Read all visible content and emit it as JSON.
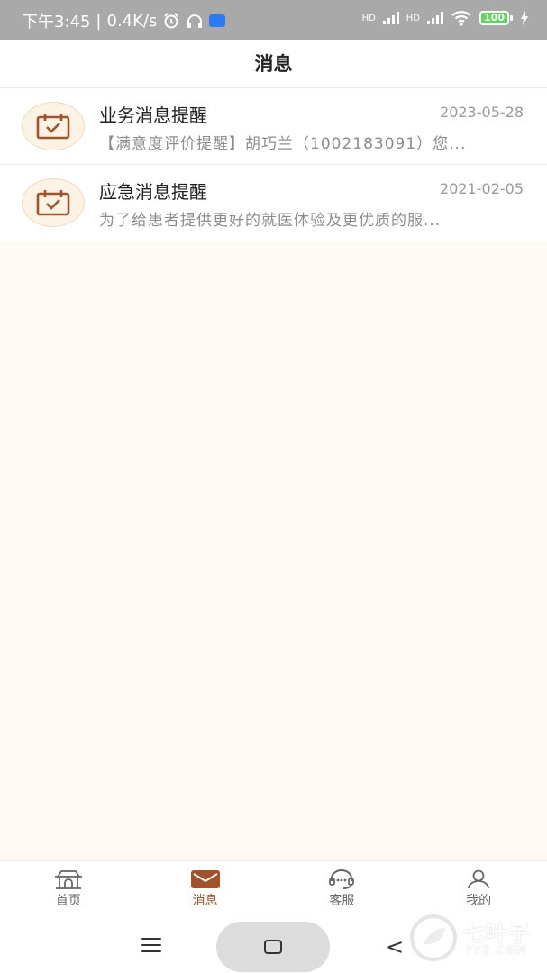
{
  "status_bar": {
    "time": "下午3:45",
    "net_speed": "0.4K/s",
    "battery": "100",
    "hd1": "HD",
    "hd2": "HD"
  },
  "header": {
    "title": "消息"
  },
  "messages": [
    {
      "title": "业务消息提醒",
      "date": "2023-05-28",
      "preview": "【满意度评价提醒】胡巧兰（1002183091）您..."
    },
    {
      "title": "应急消息提醒",
      "date": "2021-02-05",
      "preview": "为了给患者提供更好的就医体验及更优质的服..."
    }
  ],
  "bottom_nav": {
    "items": [
      {
        "label": "首页",
        "icon": "home-icon"
      },
      {
        "label": "消息",
        "icon": "mail-icon",
        "active": true
      },
      {
        "label": "客服",
        "icon": "headset-icon"
      },
      {
        "label": "我的",
        "icon": "person-icon"
      }
    ]
  },
  "watermark": {
    "text": "七叶子",
    "sub": "7YZ.COM"
  },
  "colors": {
    "accent": "#a0522d",
    "background": "#fffaf4",
    "statusbar": "#a9a9a9"
  }
}
